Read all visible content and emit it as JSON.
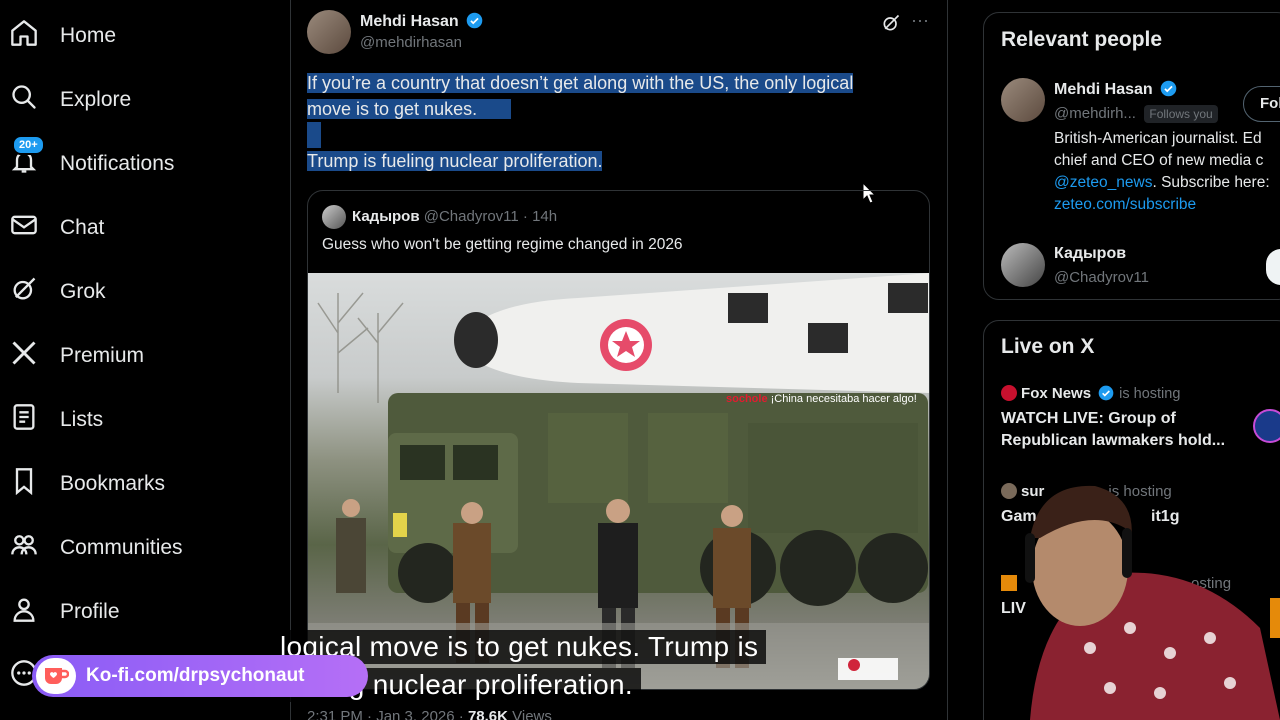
{
  "nav": {
    "items": [
      {
        "label": "Home",
        "icon": "home-icon"
      },
      {
        "label": "Explore",
        "icon": "search-icon"
      },
      {
        "label": "Notifications",
        "icon": "bell-icon",
        "badge": "20+"
      },
      {
        "label": "Chat",
        "icon": "mail-icon"
      },
      {
        "label": "Grok",
        "icon": "grok-icon"
      },
      {
        "label": "Premium",
        "icon": "x-logo-icon"
      },
      {
        "label": "Lists",
        "icon": "list-icon"
      },
      {
        "label": "Bookmarks",
        "icon": "bookmark-icon"
      },
      {
        "label": "Communities",
        "icon": "communities-icon"
      },
      {
        "label": "Profile",
        "icon": "profile-icon"
      }
    ]
  },
  "tweet": {
    "author_name": "Mehdi Hasan",
    "author_handle": "@mehdirhasan",
    "line1": "If you’re a country that doesn’t get along with the US, the only logical",
    "line2": "move is to get nukes.",
    "line3": "Trump is fueling nuclear proliferation.",
    "timestamp": "2:31 PM · Jan 3, 2026 ·",
    "views_count": "78.6K",
    "views_label": "Views",
    "quote": {
      "author_name": "Кадыров",
      "author_handle": "@Chadyrov11",
      "age": "· 14h",
      "text": "Guess who won't be getting regime changed in 2026",
      "media_overlay_user": "sochole",
      "media_overlay_text": "¡China necesitaba hacer algo!"
    }
  },
  "sidebar": {
    "relevant_title": "Relevant people",
    "person1": {
      "name": "Mehdi Hasan",
      "handle": "@mehdirh...",
      "follows_you": "Follows you",
      "follow_label": "Fol",
      "bio_line1": "British-American journalist. Ed",
      "bio_line2": "chief and CEO of new media c",
      "bio_mention": "@zeteo_news",
      "bio_after_mention": ". Subscribe here:",
      "bio_link": "zeteo.com/subscribe"
    },
    "person2": {
      "name": "Кадыров",
      "handle": "@Chadyrov11"
    },
    "live_title": "Live on X",
    "live": [
      {
        "host": "Fox News",
        "status": "is hosting",
        "title_line1": "WATCH LIVE: Group of",
        "title_line2": "Republican lawmakers hold..."
      },
      {
        "host": "sur",
        "status": "is hosting",
        "title_line1": "Gam",
        "title_line1b": "it1g"
      },
      {
        "host": "",
        "status": "osting",
        "title_line1": "LIV"
      }
    ]
  },
  "overlay": {
    "caption_line1": "logical move is to get nukes. Trump is",
    "caption_line2": "fueling nuclear proliferation.",
    "kofi_text": "Ko-fi.com/drpsychonaut"
  },
  "colors": {
    "background": "#000000",
    "accent": "#1d9bf0",
    "selection": "#1a4a8a",
    "kofi": "#a066f6"
  }
}
